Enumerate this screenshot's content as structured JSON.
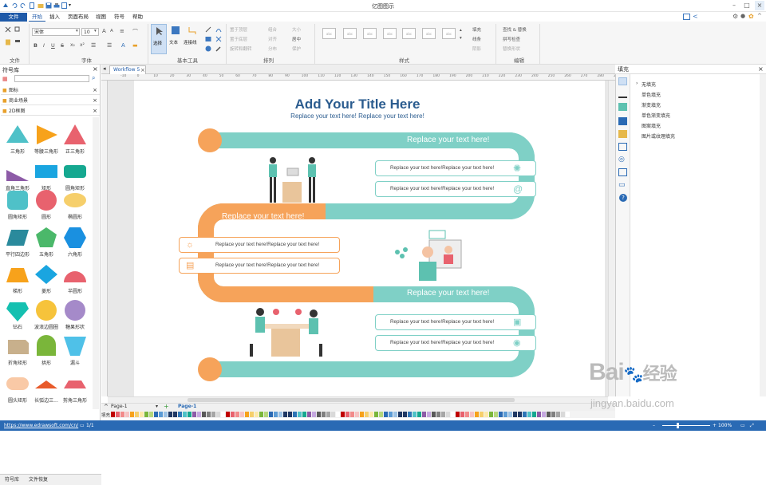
{
  "app": {
    "window_title": "亿图图示"
  },
  "menu": [
    "文件",
    "开始",
    "插入",
    "页面布局",
    "视图",
    "符号",
    "帮助"
  ],
  "ribbon": {
    "font_name": "宋体",
    "font_size": "10",
    "tool_labels": [
      "选择",
      "文本",
      "连接线"
    ],
    "arrange_items": [
      "置于顶层",
      "置于底层",
      "旋转和翻转",
      "组合",
      "对齐",
      "分布",
      "大小",
      "居中",
      "保护"
    ],
    "fill_items": [
      "填充",
      "线条",
      "阴影"
    ],
    "edit_items": [
      "查找 & 替换",
      "拼写检查",
      "替换形状"
    ],
    "style_box_label": "abc",
    "groups": [
      "文件",
      "字体",
      "基本工具",
      "排列",
      "样式",
      "编辑"
    ]
  },
  "left_panel": {
    "title": "符号库",
    "libraries": [
      "图标",
      "商业场景",
      "2D框图"
    ],
    "shapes": [
      "三角形",
      "等腰三角形",
      "正三角形",
      "直角三角形",
      "矩形",
      "圆角矩形",
      "圆角矩形",
      "圆形",
      "椭圆形",
      "平行四边形",
      "五角形",
      "六角形",
      "梯形",
      "菱形",
      "半圆形",
      "钻石",
      "波浪边圆圈",
      "糖果形状",
      "折角矩形",
      "拱形",
      "漏斗",
      "圆头矩形",
      "长弧边三...",
      "剪角三角形"
    ],
    "bottom_tabs": [
      "符号库",
      "文件恢复"
    ]
  },
  "document": {
    "tab_name": "Workflow 5",
    "ruler_numbers": [
      "-10",
      "0",
      "10",
      "20",
      "30",
      "40",
      "50",
      "60",
      "70",
      "80",
      "90",
      "100",
      "110",
      "120",
      "130",
      "140",
      "150",
      "160",
      "170",
      "180",
      "190",
      "200",
      "210",
      "220",
      "230",
      "240",
      "250",
      "260",
      "270",
      "280",
      "290"
    ],
    "page_tab": "Page-1",
    "page_tab_active": "Page-1",
    "palette_label": "填充"
  },
  "diagram": {
    "title": "Add Your Title Here",
    "subtitle": "Replace your text here!   Replace your text here!",
    "band_headings": [
      "Replace your text here!",
      "Replace your text here!",
      "Replace your text here!"
    ],
    "item_text": "Replace your text here!Replace your text here!",
    "colors": {
      "teal": "#7fd0c6",
      "orange": "#f6a35a",
      "title": "#2b5c8f"
    }
  },
  "right_panel": {
    "title": "填充",
    "options": [
      "无填充",
      "单色填充",
      "渐变填充",
      "单色渐变填充",
      "图案填充",
      "图片或纹理填充"
    ]
  },
  "status": {
    "url": "https://www.edrawsoft.com/cn/",
    "page_info": "1/1",
    "zoom": "100%"
  },
  "watermark": {
    "brand": "Bai",
    "brand_cn": "经验",
    "domain": "jingyan.baidu.com"
  }
}
